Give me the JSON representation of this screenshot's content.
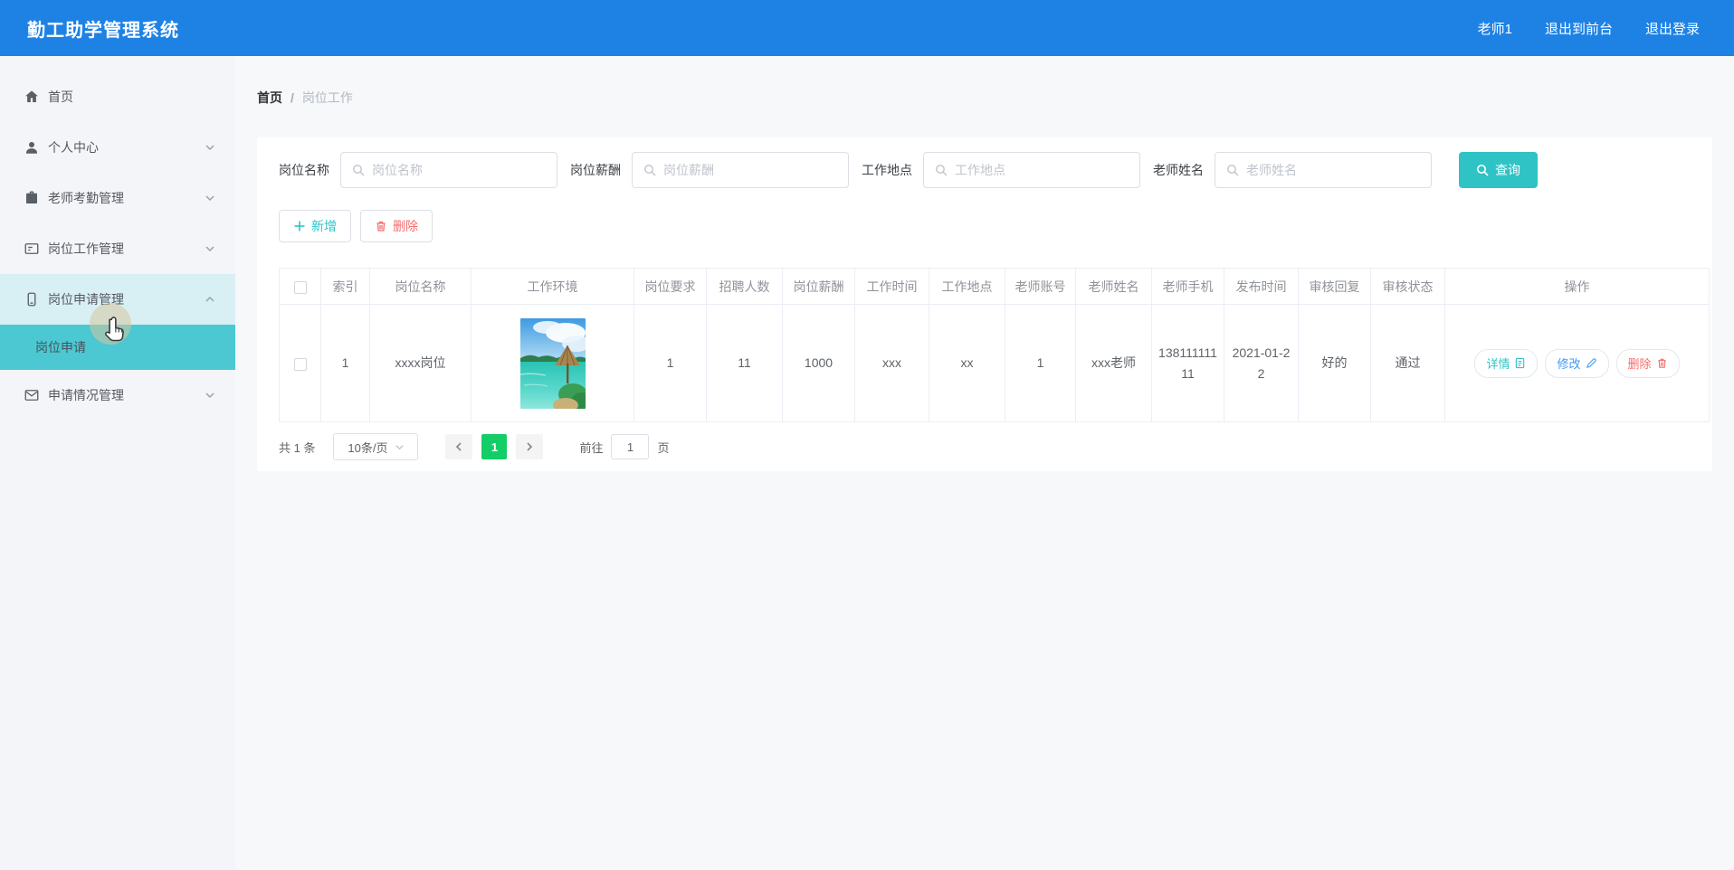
{
  "app": {
    "title": "勤工助学管理系统"
  },
  "header": {
    "username": "老师1",
    "logout_front_label": "退出到前台",
    "logout_label": "退出登录"
  },
  "sidebar": {
    "items": [
      {
        "label": "首页",
        "icon": "home-icon",
        "has_children": false
      },
      {
        "label": "个人中心",
        "icon": "user-icon",
        "has_children": true,
        "expanded": false
      },
      {
        "label": "老师考勤管理",
        "icon": "briefcase-icon",
        "has_children": true,
        "expanded": false
      },
      {
        "label": "岗位工作管理",
        "icon": "form-icon",
        "has_children": true,
        "expanded": false
      },
      {
        "label": "岗位申请管理",
        "icon": "mobile-icon",
        "has_children": true,
        "expanded": true,
        "active": true,
        "children": [
          {
            "label": "岗位申请",
            "active": true
          }
        ]
      },
      {
        "label": "申请情况管理",
        "icon": "mail-icon",
        "has_children": true,
        "expanded": false
      }
    ]
  },
  "breadcrumb": {
    "root": "首页",
    "separator": "/",
    "current": "岗位工作"
  },
  "filters": {
    "job_name": {
      "label": "岗位名称",
      "placeholder": "岗位名称",
      "value": ""
    },
    "salary": {
      "label": "岗位薪酬",
      "placeholder": "岗位薪酬",
      "value": ""
    },
    "place": {
      "label": "工作地点",
      "placeholder": "工作地点",
      "value": ""
    },
    "teacher": {
      "label": "老师姓名",
      "placeholder": "老师姓名",
      "value": ""
    },
    "search_label": "查询"
  },
  "toolbar": {
    "add_label": "新增",
    "delete_label": "删除"
  },
  "table": {
    "headers": [
      "索引",
      "岗位名称",
      "工作环境",
      "岗位要求",
      "招聘人数",
      "岗位薪酬",
      "工作时间",
      "工作地点",
      "老师账号",
      "老师姓名",
      "老师手机",
      "发布时间",
      "审核回复",
      "审核状态",
      "操作"
    ],
    "rows": [
      {
        "index": "1",
        "job_name": "xxxx岗位",
        "work_env_image": "tropical-beach-photo",
        "requirement": "1",
        "recruit_count": "11",
        "salary": "1000",
        "work_time": "xxx",
        "work_place": "xx",
        "teacher_account": "1",
        "teacher_name": "xxx老师",
        "teacher_phone": "13811111111",
        "publish_date": "2021-01-22",
        "audit_reply": "好的",
        "audit_status": "通过"
      }
    ],
    "row_actions": {
      "detail": "详情",
      "edit": "修改",
      "delete": "删除"
    }
  },
  "pagination": {
    "total_text": "共 1 条",
    "page_size": "10条/页",
    "current_page": "1",
    "goto_label": "前往",
    "goto_value": "1",
    "goto_unit": "页"
  },
  "colors": {
    "header_blue": "#1E82E5",
    "accent_teal": "#2FC3C6",
    "submenu_active_teal": "#4BC8D2",
    "menu_active_light": "#D8EFF4",
    "pager_active_green": "#13CE66",
    "danger_red": "#F56C6C",
    "link_blue": "#4098F7"
  }
}
